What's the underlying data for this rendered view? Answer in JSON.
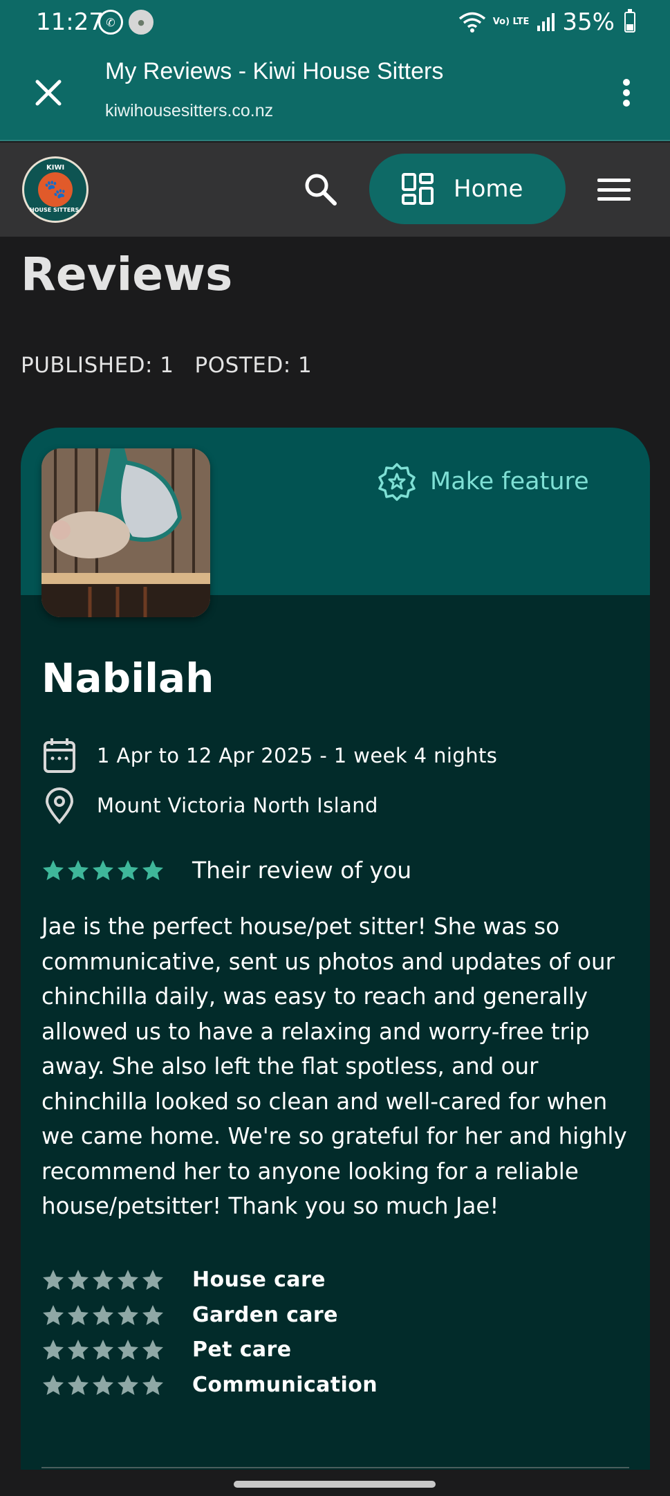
{
  "status_bar": {
    "time": "11:27",
    "left_icons": [
      "whatsapp-icon",
      "app-notification-icon"
    ],
    "battery_percent": "35%",
    "network": "Vo) LTE",
    "battery_level": 0.35
  },
  "browser": {
    "page_title": "My Reviews - Kiwi House Sitters",
    "url": "kiwihousesitters.co.nz"
  },
  "site_nav": {
    "logo_top_text": "KIWI",
    "logo_side_text": "HOUSE SITTERS",
    "home_label": "Home"
  },
  "page": {
    "title": "Reviews",
    "published": "PUBLISHED: 1",
    "posted": "POSTED: 1"
  },
  "review": {
    "make_feature_label": "Make feature",
    "reviewer_name": "Nabilah",
    "dates": "1 Apr to 12 Apr 2025 - 1 week 4 nights",
    "location": "Mount Victoria North Island",
    "overall_rating": 5,
    "overall_label": "Their review of you",
    "text": "Jae is the perfect house/pet sitter! She was so communicative, sent us photos and updates of our chinchilla daily, was easy to reach and generally allowed us to have a relaxing and worry-free trip away. She also left the flat spotless, and our chinchilla looked so clean and well-cared for when we came home. We're so grateful for her and highly recommend her to anyone looking for a reliable house/petsitter! Thank you so much Jae!",
    "categories": [
      {
        "label": "House care",
        "rating": 5
      },
      {
        "label": "Garden care",
        "rating": 5
      },
      {
        "label": "Pet care",
        "rating": 5
      },
      {
        "label": "Communication",
        "rating": 5
      }
    ]
  },
  "colors": {
    "brand_teal": "#0d6a66",
    "card_dark": "#022b2a",
    "card_header": "#025352",
    "accent": "#7fe0d5",
    "star_filled": "#3fb79a",
    "star_muted": "#8fa8a6"
  }
}
